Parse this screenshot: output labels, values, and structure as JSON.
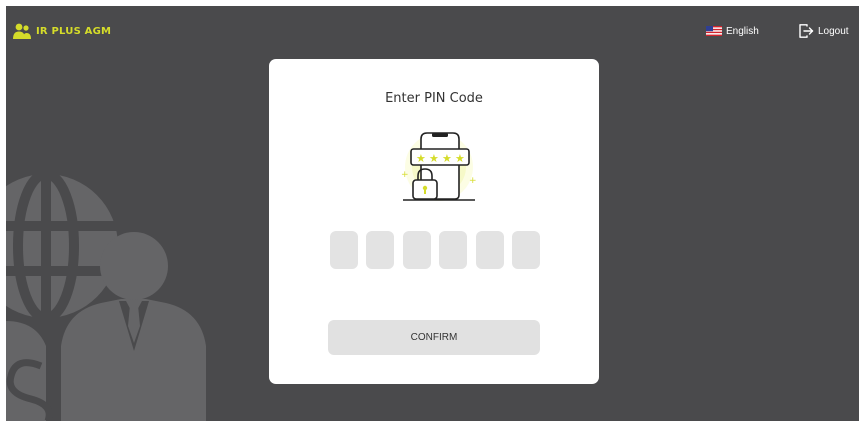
{
  "header": {
    "brand_name": "IR PLUS AGM",
    "language_label": "English",
    "logout_label": "Logout"
  },
  "pin_dialog": {
    "title": "Enter PIN Code",
    "digit_count": 6,
    "confirm_label": "CONFIRM"
  },
  "icons": {
    "brand": "people-logo-icon",
    "language": "us-flag-icon",
    "logout": "logout-icon",
    "illustration": "phone-password-lock-icon",
    "background": "globe-businessman-icon"
  },
  "colors": {
    "background": "#4a4a4c",
    "brand": "#d5dc2a",
    "card": "#ffffff",
    "pin_box": "#e3e3e3",
    "button": "#e1e1e1"
  }
}
